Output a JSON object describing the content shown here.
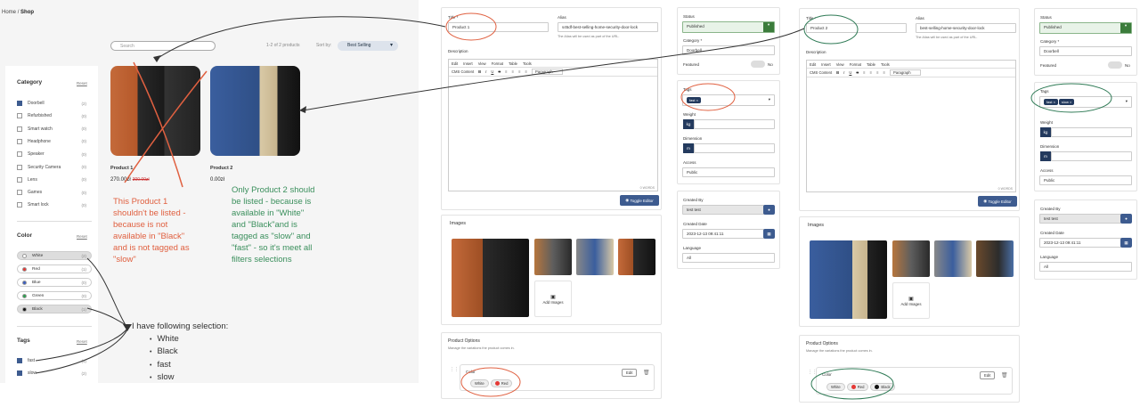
{
  "shop": {
    "breadcrumb_home": "Home",
    "breadcrumb_sep": "/",
    "breadcrumb_current": "Shop",
    "search_placeholder": "Search",
    "count": "1-2 of 2 products",
    "sort_label": "Sort by:",
    "sort_value": "Best Selling",
    "category": {
      "title": "Category",
      "reset": "Reset",
      "items": [
        {
          "label": "Doorbell",
          "count": "(2)",
          "checked": true
        },
        {
          "label": "Refurbished",
          "count": "(0)",
          "checked": false
        },
        {
          "label": "Smart watch",
          "count": "(0)",
          "checked": false
        },
        {
          "label": "Headphone",
          "count": "(0)",
          "checked": false
        },
        {
          "label": "Speaker",
          "count": "(0)",
          "checked": false
        },
        {
          "label": "Security Camera",
          "count": "(0)",
          "checked": false
        },
        {
          "label": "Lens",
          "count": "(0)",
          "checked": false
        },
        {
          "label": "Games",
          "count": "(0)",
          "checked": false
        },
        {
          "label": "Smart lock",
          "count": "(0)",
          "checked": false
        }
      ]
    },
    "color": {
      "title": "Color",
      "reset": "Reset",
      "items": [
        {
          "label": "White",
          "count": "(2)",
          "color": "#ffffff",
          "selected": true
        },
        {
          "label": "Red",
          "count": "(1)",
          "color": "#e53935",
          "selected": false
        },
        {
          "label": "Blue",
          "count": "(0)",
          "color": "#3b5fc0",
          "selected": false
        },
        {
          "label": "Green",
          "count": "(0)",
          "color": "#2e9e4f",
          "selected": false
        },
        {
          "label": "Black",
          "count": "(1)",
          "color": "#111111",
          "selected": true
        }
      ]
    },
    "tags": {
      "title": "Tags",
      "reset": "Reset",
      "items": [
        {
          "label": "fast",
          "count": "(1)",
          "checked": true
        },
        {
          "label": "slow",
          "count": "(2)",
          "checked": true
        }
      ]
    },
    "products": [
      {
        "title": "Product 1",
        "price": "270.00zł",
        "old_price": "300.00zł"
      },
      {
        "title": "Product 2",
        "price": "0.00zł",
        "old_price": ""
      }
    ]
  },
  "annotations": {
    "red_text": "This Product 1 shouldn't be listed - because is not available in \"Black\" and is not tagged as \"slow\"",
    "green_text": "Only Product 2 should be listed - because is available in \"White\" and \"Black\"and is tagged as \"slow\" and \"fast\" - so it's meet all filters selections",
    "note_title": "I have following selection:",
    "note_items": [
      "White",
      "Black",
      "fast",
      "slow"
    ],
    "red_color": "#e06040",
    "green_color": "#3a8f5c"
  },
  "editor1": {
    "title_label": "Title *",
    "title_value": "Product 1",
    "alias_label": "Alias",
    "alias_value": "s45df-best-selling-home-security-door-lock",
    "alias_help": "The Alias will be used as part of the URL.",
    "description_label": "Description",
    "menu": [
      "Edit",
      "Insert",
      "View",
      "Format",
      "Table",
      "Tools"
    ],
    "cms_content": "CMS Content",
    "paragraph": "Paragraph",
    "words": "0 WORDS",
    "toggle": "Toggle Editor",
    "images_label": "Images",
    "add_images": "Add Images",
    "options_title": "Product Options",
    "options_help": "Manage the variations the product comes in.",
    "option_name": "Color",
    "option_edit": "Edit",
    "chips": [
      {
        "label": "White",
        "color": "#ffffff"
      },
      {
        "label": "Red",
        "color": "#e53935"
      }
    ],
    "status_label": "Status",
    "status_value": "Published",
    "category_label": "Category *",
    "category_value": "Doorbell",
    "featured_label": "Featured",
    "featured_value": "No",
    "tags_label": "Tags",
    "tags": [
      "fast"
    ],
    "weight_label": "Weight",
    "weight_unit": "kg",
    "dimension_label": "Dimension",
    "dimension_unit": "m",
    "access_label": "Access",
    "access_value": "Public",
    "created_by_label": "Created By",
    "created_by_value": "test test",
    "created_date_label": "Created Date",
    "created_date_value": "2023-12-13 09:41:11",
    "language_label": "Language",
    "language_value": "All"
  },
  "editor2": {
    "title_label": "Title *",
    "title_value": "Product 2",
    "alias_label": "Alias",
    "alias_value": "best-selling-home-security-door-lock",
    "alias_help": "The Alias will be used as part of the URL.",
    "description_label": "Description",
    "menu": [
      "Edit",
      "Insert",
      "View",
      "Format",
      "Table",
      "Tools"
    ],
    "cms_content": "CMS Content",
    "paragraph": "Paragraph",
    "words": "0 WORDS",
    "toggle": "Toggle Editor",
    "images_label": "Images",
    "add_images": "Add Images",
    "options_title": "Product Options",
    "options_help": "Manage the variations the product comes in.",
    "option_name": "Color",
    "option_edit": "Edit",
    "chips": [
      {
        "label": "White",
        "color": "#ffffff"
      },
      {
        "label": "Red",
        "color": "#e53935"
      },
      {
        "label": "Black",
        "color": "#111111"
      }
    ],
    "status_label": "Status",
    "status_value": "Published",
    "category_label": "Category *",
    "category_value": "Doorbell",
    "featured_label": "Featured",
    "featured_value": "No",
    "tags_label": "Tags",
    "tags": [
      "fast",
      "slow"
    ],
    "weight_label": "Weight",
    "weight_unit": "kg",
    "dimension_label": "Dimension",
    "dimension_unit": "m",
    "access_label": "Access",
    "access_value": "Public",
    "created_by_label": "Created By",
    "created_by_value": "test test",
    "created_date_label": "Created Date",
    "created_date_value": "2023-12-13 09:41:11",
    "language_label": "Language",
    "language_value": "All"
  }
}
